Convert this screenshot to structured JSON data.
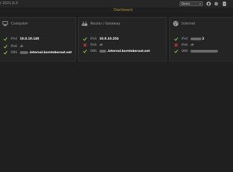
{
  "header": {
    "app_title": "r 2021.6.0",
    "environment_select": {
      "value": "Demo",
      "chevron": "chevron-down-icon"
    },
    "icons": [
      "github-icon",
      "gear-icon",
      "server-icon"
    ]
  },
  "nav": {
    "dashboard_label": "Dashboard"
  },
  "colors": {
    "ok": "#8bc34a",
    "fail": "#e53935",
    "accent": "#b69a3a"
  },
  "cards": [
    {
      "title": "Computer",
      "icon": "computer-icon",
      "rows": [
        {
          "status": "ok",
          "label": "IPv4",
          "value": "10.0.10.140"
        },
        {
          "status": "ok",
          "label": "IPv6",
          "value": "-/-"
        },
        {
          "status": "ok",
          "label": "DNS",
          "value": ".internal.borntoberoot.net"
        }
      ]
    },
    {
      "title": "Router / Gateway",
      "icon": "router-icon",
      "rows": [
        {
          "status": "ok",
          "label": "IPv4",
          "value": "10.0.10.254"
        },
        {
          "status": "fail",
          "label": "IPv6",
          "value": "-/-"
        },
        {
          "status": "ok",
          "label": "DNS",
          "value": ".internal.borntoberoot.net"
        }
      ]
    },
    {
      "title": "Internet",
      "icon": "globe-icon",
      "rows": [
        {
          "status": "ok",
          "label": "IPv4",
          "value": "2"
        },
        {
          "status": "fail",
          "label": "IPv6",
          "value": "-/-"
        },
        {
          "status": "ok",
          "label": "DNS",
          "value": ""
        }
      ]
    }
  ]
}
